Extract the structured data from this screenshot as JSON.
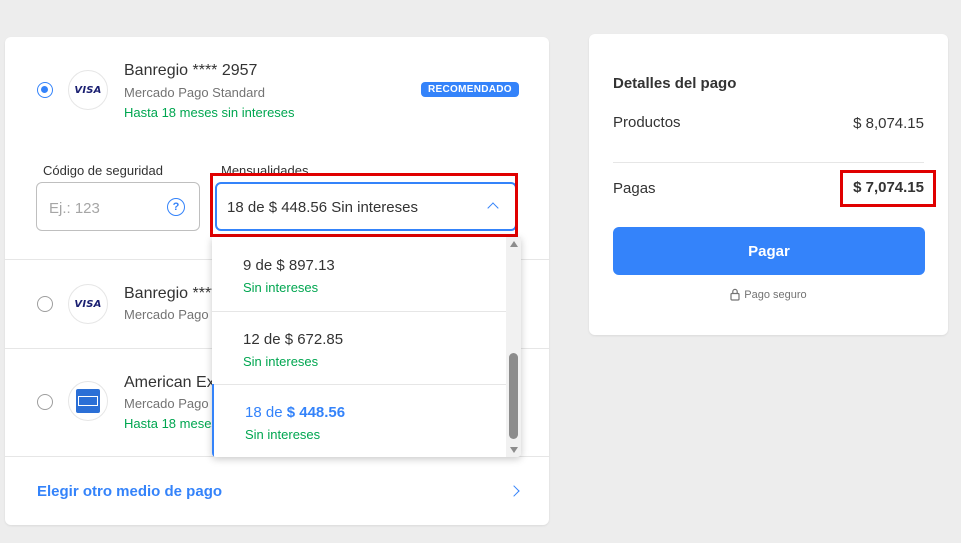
{
  "payment_methods": [
    {
      "title": "Banregio **** 2957",
      "subtitle": "Mercado Pago Standard",
      "promo": "Hasta 18 meses sin intereses",
      "badge": "RECOMENDADO",
      "logo": "VISA",
      "selected": true
    },
    {
      "title": "Banregio ****",
      "subtitle": "Mercado Pago",
      "logo": "VISA",
      "selected": false
    },
    {
      "title": "American Ex",
      "subtitle": "Mercado Pago",
      "promo": "Hasta 18 meses",
      "logo": "amex-icon",
      "selected": false
    }
  ],
  "security_code": {
    "label": "Código de seguridad",
    "placeholder": "Ej.: 123",
    "help_icon": "?"
  },
  "installments": {
    "label": "Mensualidades",
    "selected": "18 de $ 448.56 Sin intereses",
    "options": [
      {
        "label": "9 de $ 897.13",
        "sub": "Sin intereses"
      },
      {
        "label": "12 de $ 672.85",
        "sub": "Sin intereses"
      },
      {
        "label_prefix": "18 de ",
        "label_amount": "$ 448.56",
        "sub": "Sin intereses",
        "selected": true
      }
    ]
  },
  "other_method": "Elegir otro medio de pago",
  "summary": {
    "title": "Detalles del pago",
    "products_label": "Productos",
    "products_value": "$ 8,074.15",
    "pay_label": "Pagas",
    "pay_value": "$ 7,074.15",
    "button": "Pagar",
    "secure": "Pago seguro"
  },
  "colors": {
    "accent": "#3483fa",
    "green": "#00a650",
    "highlight": "#e00000"
  }
}
